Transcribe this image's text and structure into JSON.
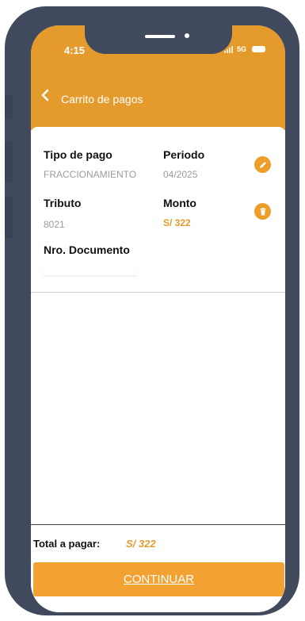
{
  "status_bar": {
    "time": "4:15",
    "network": "5G"
  },
  "header": {
    "title": "Carrito de pagos",
    "background_color": "#e49b2c"
  },
  "cart_item": {
    "tipo_pago_label": "Tipo de pago",
    "tipo_pago_value": "FRACCIONAMIENTO",
    "periodo_label": "Periodo",
    "periodo_value": "04/2025",
    "tributo_label": "Tributo",
    "tributo_value": "8021",
    "monto_label": "Monto",
    "monto_value": "S/ 322",
    "nro_documento_label": "Nro. Documento",
    "nro_documento_value": "",
    "edit_icon": "pencil-icon",
    "delete_icon": "trash-icon"
  },
  "footer": {
    "total_label": "Total a pagar:",
    "total_value": "S/ 322",
    "continue_label": "CONTINUAR",
    "accent_color": "#f2a232"
  }
}
